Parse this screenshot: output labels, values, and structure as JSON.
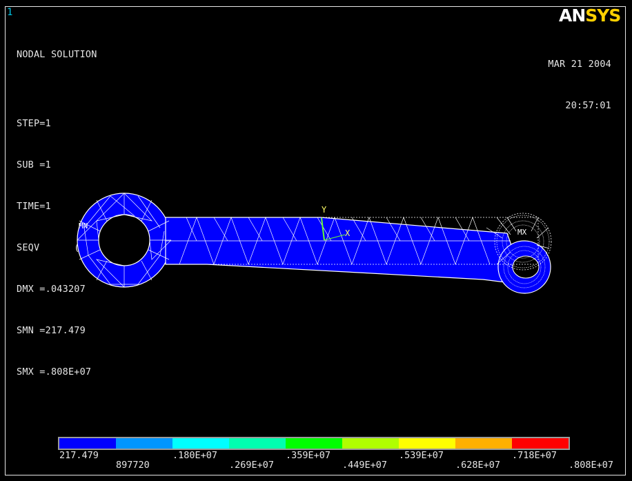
{
  "window": {
    "number": "1"
  },
  "logo": {
    "part1": "AN",
    "part2": "SYS"
  },
  "info": {
    "lines": [
      "NODAL SOLUTION",
      "",
      "STEP=1",
      "SUB =1",
      "TIME=1",
      "SEQV      (AVG)",
      "DMX =.043207",
      "SMN =217.479",
      "SMX =.808E+07"
    ]
  },
  "timestamp": {
    "date": "MAR 21 2004",
    "time": "20:57:01"
  },
  "annotations": {
    "min_marker": "MN",
    "max_marker": "MX",
    "axis_y": "Y",
    "axis_x": "X"
  },
  "legend": {
    "colors": [
      "#0000ff",
      "#0096ff",
      "#00ffff",
      "#00ffb0",
      "#00ff00",
      "#b0ff00",
      "#ffff00",
      "#ffb000",
      "#ff0000"
    ],
    "upper_labels": [
      "217.479",
      ".180E+07",
      ".359E+07",
      ".539E+07",
      ".718E+07"
    ],
    "lower_labels": [
      "897720",
      ".269E+07",
      ".449E+07",
      ".628E+07",
      ".808E+07"
    ]
  },
  "accent_colors": {
    "logo_an": "#ffffff",
    "logo_sys": "#ffd000",
    "window_number": "#00c8e8",
    "model_fill": "#0000ff"
  }
}
